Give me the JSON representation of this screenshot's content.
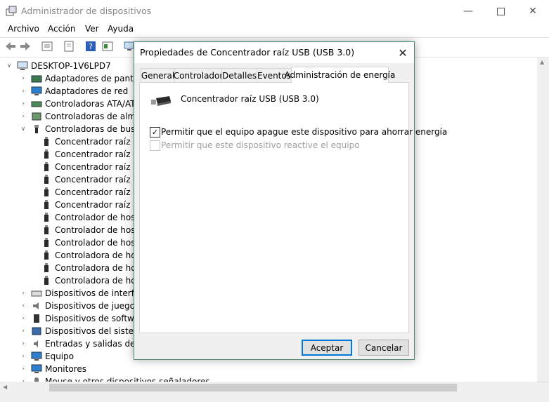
{
  "window": {
    "title": "Administrador de dispositivos"
  },
  "menu": [
    "Archivo",
    "Acción",
    "Ver",
    "Ayuda"
  ],
  "tree": {
    "root": "DESKTOP-1V6LPD7",
    "categories": [
      {
        "label": "Adaptadores de pantalla",
        "icon": "display-adapter-icon"
      },
      {
        "label": "Adaptadores de red",
        "icon": "network-adapter-icon"
      },
      {
        "label": "Controladoras ATA/ATA",
        "icon": "ata-controller-icon"
      },
      {
        "label": "Controladoras de almac",
        "icon": "storage-controller-icon"
      },
      {
        "label": "Controladoras de bus se",
        "icon": "usb-controller-icon",
        "expanded": true,
        "children": [
          "Concentrador raíz U",
          "Concentrador raíz U",
          "Concentrador raíz U",
          "Concentrador raíz U",
          "Concentrador raíz U",
          "Concentrador raíz U",
          "Controlador de host",
          "Controlador de host",
          "Controlador de host",
          "Controladora de hos",
          "Controladora de hos",
          "Controladora de hos"
        ]
      },
      {
        "label": "Dispositivos de interfaz",
        "icon": "hid-icon"
      },
      {
        "label": "Dispositivos de juego, so",
        "icon": "sound-icon"
      },
      {
        "label": "Dispositivos de software",
        "icon": "software-device-icon"
      },
      {
        "label": "Dispositivos del sistema",
        "icon": "system-device-icon"
      },
      {
        "label": "Entradas y salidas de au",
        "icon": "audio-io-icon"
      },
      {
        "label": "Equipo",
        "icon": "computer-icon"
      },
      {
        "label": "Monitores",
        "icon": "monitor-icon"
      },
      {
        "label": "Mouse y otros dispositivos señaladores",
        "icon": "mouse-icon"
      }
    ]
  },
  "dialog": {
    "title": "Propiedades de Concentrador raíz USB (USB 3.0)",
    "tabs": [
      "General",
      "Controlador",
      "Detalles",
      "Eventos",
      "Administración de energía"
    ],
    "selected_tab": "Administración de energía",
    "device_name": "Concentrador raíz USB (USB 3.0)",
    "options": [
      {
        "label": "Permitir que el equipo apague este dispositivo para ahorrar energía",
        "checked": true,
        "enabled": true
      },
      {
        "label": "Permitir que este dispositivo reactive el equipo",
        "checked": false,
        "enabled": false
      }
    ],
    "ok_label": "Aceptar",
    "cancel_label": "Cancelar"
  },
  "colors": {
    "dialog_border": "#4a8a6a",
    "default_button_border": "#0078d7",
    "disabled_text": "#a0a0a0"
  }
}
